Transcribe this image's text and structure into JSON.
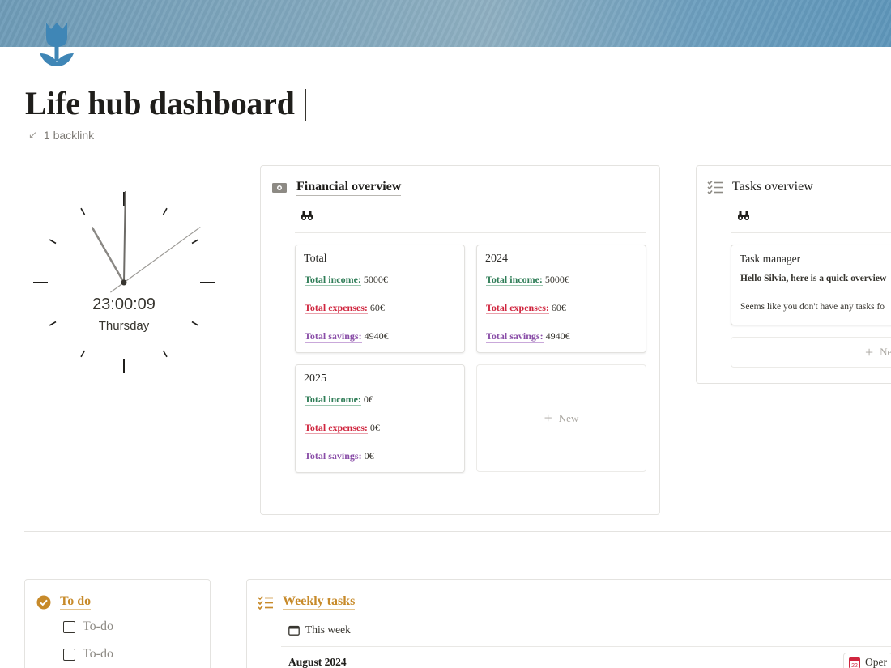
{
  "page": {
    "title": "Life hub dashboard",
    "backlink": "1 backlink"
  },
  "clock": {
    "time": "23:00:09",
    "day": "Thursday",
    "hour": 23,
    "minute": 0,
    "second": 9
  },
  "financial": {
    "title": "Financial overview",
    "cards": [
      {
        "title": "Total",
        "income_label": "Total income:",
        "income": "5000€",
        "expenses_label": "Total expenses:",
        "expenses": "60€",
        "savings_label": "Total savings:",
        "savings": "4940€"
      },
      {
        "title": "2024",
        "income_label": "Total income:",
        "income": "5000€",
        "expenses_label": "Total expenses:",
        "expenses": "60€",
        "savings_label": "Total savings:",
        "savings": "4940€"
      },
      {
        "title": "2025",
        "income_label": "Total income:",
        "income": "0€",
        "expenses_label": "Total expenses:",
        "expenses": "0€",
        "savings_label": "Total savings:",
        "savings": "0€"
      }
    ],
    "new_label": "New"
  },
  "tasks": {
    "title": "Tasks overview",
    "card_title": "Task manager",
    "greeting": "Hello Silvia, here is a quick overview",
    "note": "Seems like you don't have any tasks fo",
    "new_label": "Ne"
  },
  "todo": {
    "title": "To do",
    "items": [
      "To-do",
      "To-do"
    ]
  },
  "weekly": {
    "title": "Weekly tasks",
    "view": "This week",
    "month": "August 2024",
    "open_label": "Oper",
    "calendar_day": "22"
  },
  "colors": {
    "accent_orange": "#c78a2a",
    "income_green": "#2f7d57",
    "expenses_red": "#d0263f",
    "savings_purple": "#8a4ea8",
    "tulip_blue": "#3f86b6"
  },
  "icons": {
    "page": "tulip-icon",
    "financial": "cash-icon",
    "tasks": "checklist-icon",
    "view": "binoculars-icon",
    "todo": "check-circle-icon",
    "weekly": "checklist-icon",
    "calendar": "calendar-icon"
  }
}
